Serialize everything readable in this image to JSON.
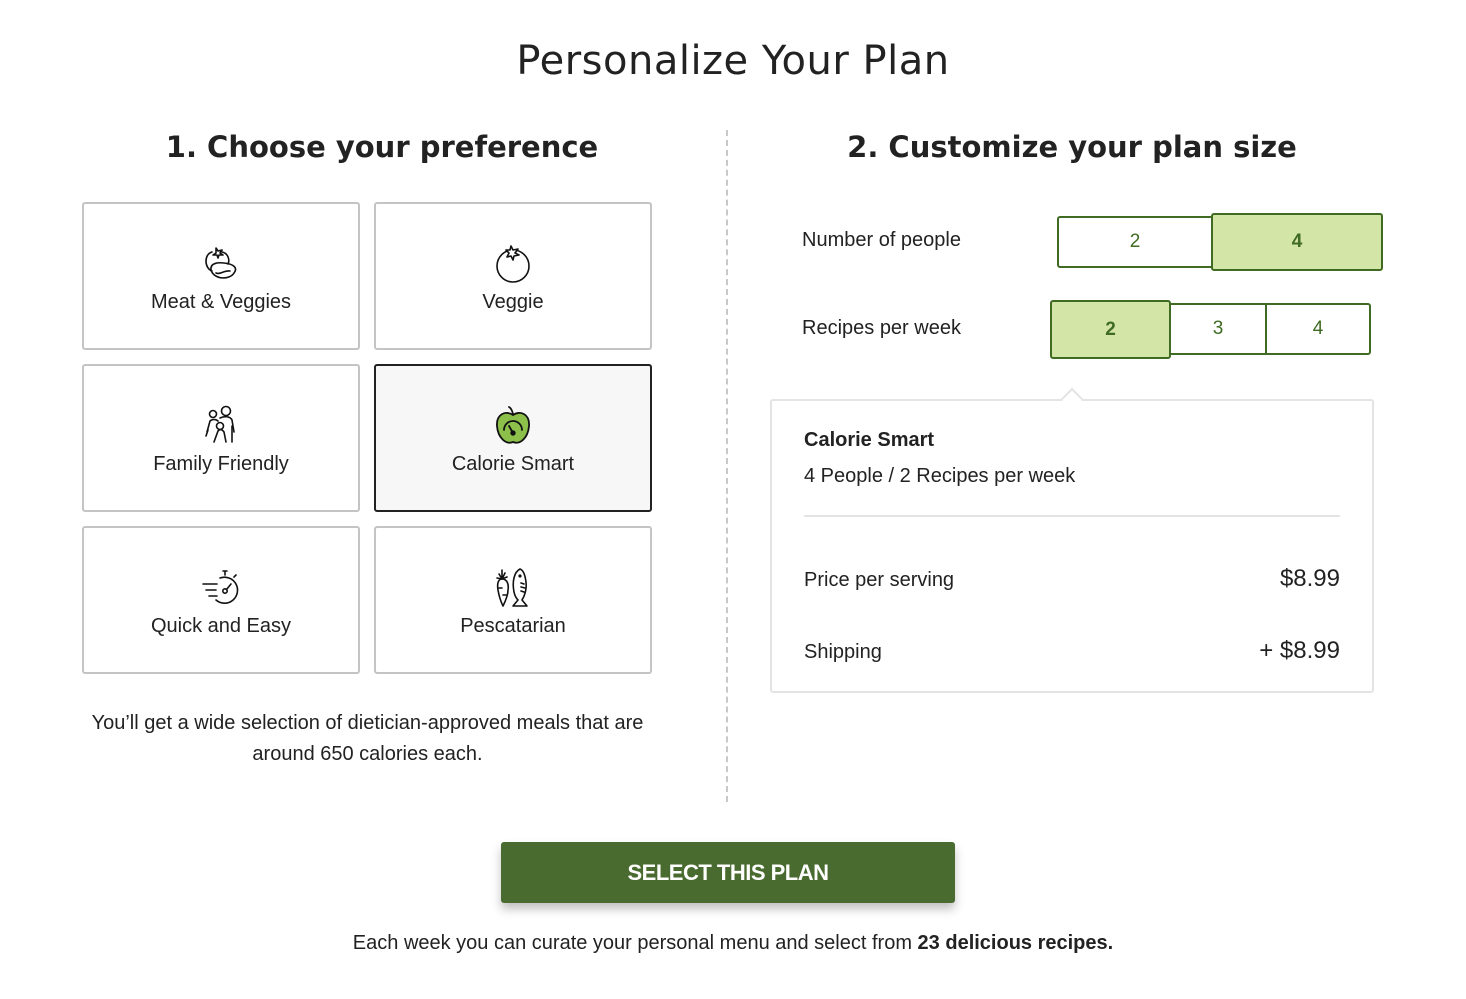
{
  "page": {
    "title": "Personalize Your Plan"
  },
  "preference": {
    "heading": "1. Choose your preference",
    "options": [
      {
        "label": "Meat & Veggies",
        "icon": "meat-veggies-icon",
        "selected": false
      },
      {
        "label": "Veggie",
        "icon": "tomato-icon",
        "selected": false
      },
      {
        "label": "Family Friendly",
        "icon": "family-icon",
        "selected": false
      },
      {
        "label": "Calorie Smart",
        "icon": "apple-gauge-icon",
        "selected": true
      },
      {
        "label": "Quick and Easy",
        "icon": "stopwatch-icon",
        "selected": false
      },
      {
        "label": "Pescatarian",
        "icon": "carrot-fish-icon",
        "selected": false
      }
    ],
    "description": "You’ll get a wide selection of dietician-approved meals that are around 650 calories each."
  },
  "plan_size": {
    "heading": "2. Customize your plan size",
    "people": {
      "label": "Number of people",
      "options": [
        "2",
        "4"
      ],
      "selected": "4"
    },
    "recipes": {
      "label": "Recipes per week",
      "options": [
        "2",
        "3",
        "4"
      ],
      "selected": "2"
    }
  },
  "summary": {
    "plan_name": "Calorie Smart",
    "plan_size": "4 People / 2 Recipes per week",
    "price_label": "Price per serving",
    "price_value": "$8.99",
    "shipping_label": "Shipping",
    "shipping_value": "+ $8.99"
  },
  "cta": {
    "label": "SELECT THIS PLAN"
  },
  "footer": {
    "prefix": "Each week you can curate your personal menu and select from ",
    "highlight": "23 delicious recipes."
  },
  "colors": {
    "accent": "#4a6b2f",
    "selected_fill": "#d4e5a8",
    "selected_border": "#3f6b22",
    "apple_green": "#8cc04b"
  }
}
